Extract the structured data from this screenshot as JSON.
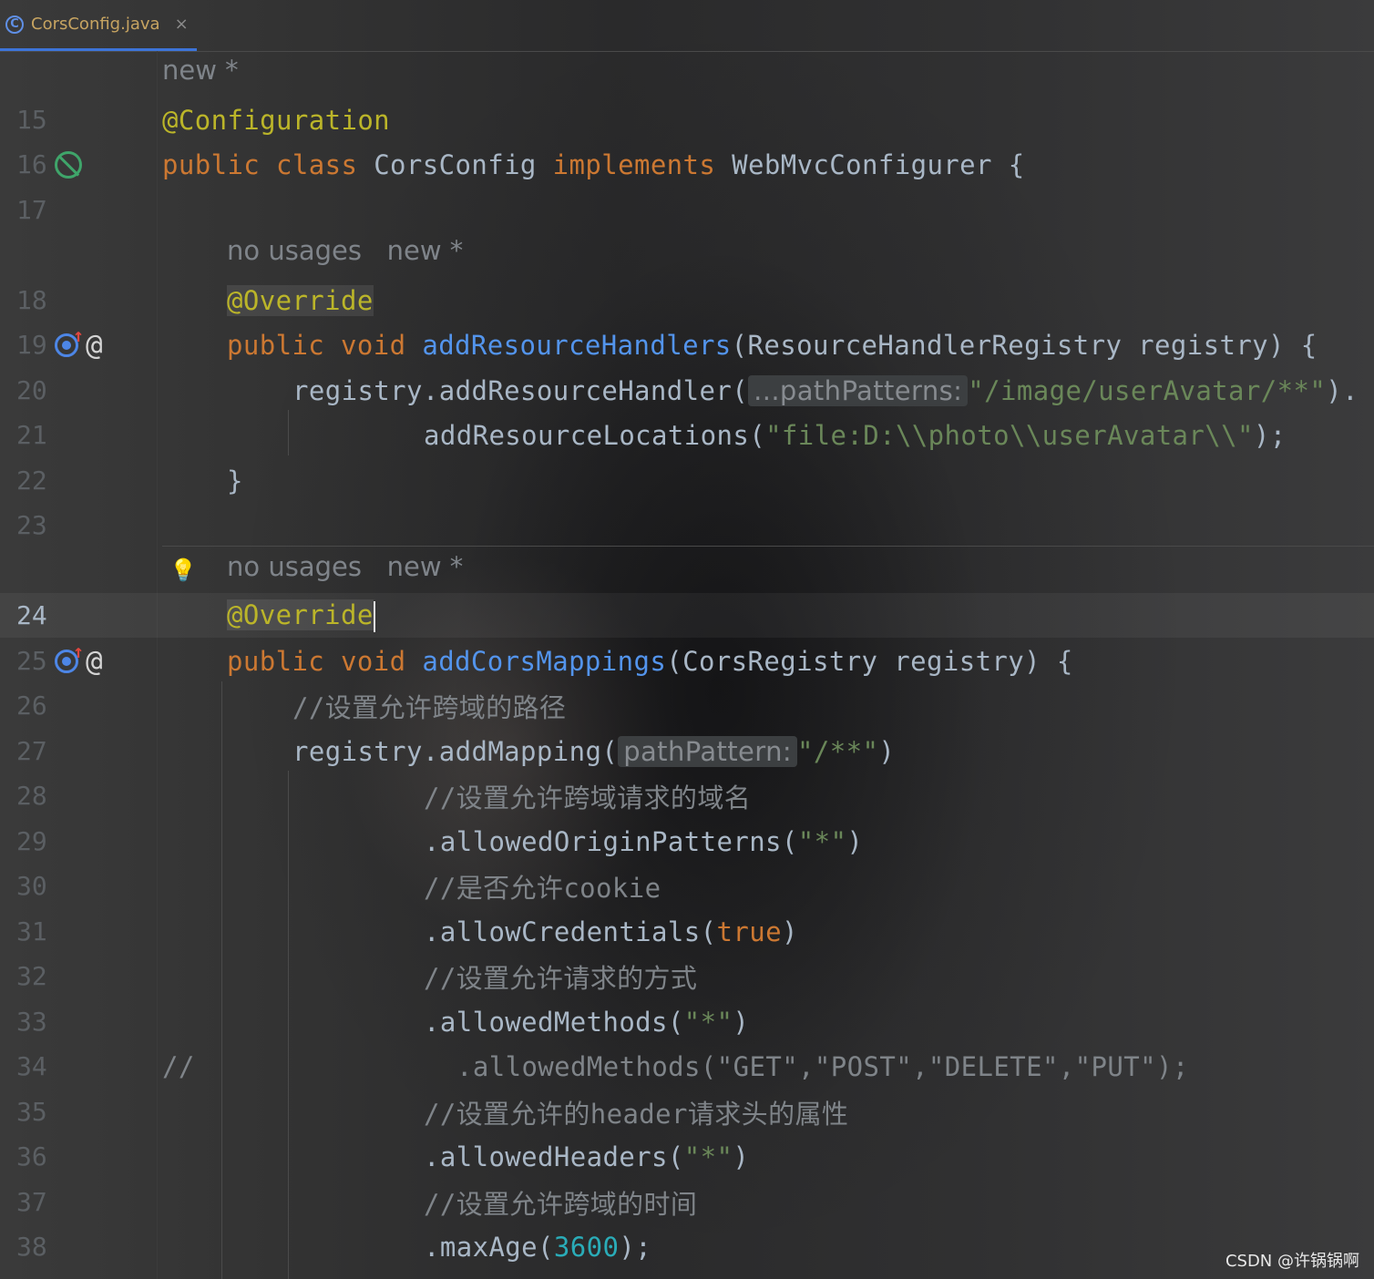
{
  "tab": {
    "icon": "class-icon",
    "icon_glyph": "C",
    "label": "CorsConfig.java",
    "close": "×"
  },
  "hints": {
    "class_author": "new *",
    "method1_usages": "no usages",
    "method1_author": "new *",
    "method2_usages": "no usages",
    "method2_author": "new *",
    "param_pathPatterns": "...pathPatterns:",
    "param_pathPattern": "pathPattern:"
  },
  "lines": {
    "n15": "15",
    "n16": "16",
    "n17": "17",
    "n18": "18",
    "n19": "19",
    "n20": "20",
    "n21": "21",
    "n22": "22",
    "n23": "23",
    "n24": "24",
    "n25": "25",
    "n26": "26",
    "n27": "27",
    "n28": "28",
    "n29": "29",
    "n30": "30",
    "n31": "31",
    "n32": "32",
    "n33": "33",
    "n34": "34",
    "n35": "35",
    "n36": "36",
    "n37": "37",
    "n38": "38"
  },
  "code": {
    "l15_ann": "@Configuration",
    "l16_kw1": "public class",
    "l16_name": " CorsConfig ",
    "l16_kw2": "implements",
    "l16_rest": " WebMvcConfigurer {",
    "l18_ann": "@Override",
    "l19_kw": "public void ",
    "l19_fn": "addResourceHandlers",
    "l19_rest": "(ResourceHandlerRegistry registry) {",
    "l20_a": "registry.addResourceHandler(",
    "l20_str": "\"/image/userAvatar/**\"",
    "l20_b": ").",
    "l21_a": "addResourceLocations(",
    "l21_str": "\"file:D:\\\\photo\\\\userAvatar\\\\\"",
    "l21_b": ");",
    "l22": "}",
    "l24_ann": "@Override",
    "l25_kw": "public void ",
    "l25_fn": "addCorsMappings",
    "l25_rest": "(CorsRegistry registry) {",
    "l26": "//设置允许跨域的路径",
    "l27_a": "registry.addMapping(",
    "l27_str": "\"/**\"",
    "l27_b": ")",
    "l28": "//设置允许跨域请求的域名",
    "l29_a": ".allowedOriginPatterns(",
    "l29_str": "\"*\"",
    "l29_b": ")",
    "l30": "//是否允许cookie",
    "l31_a": ".allowCredentials(",
    "l31_kw": "true",
    "l31_b": ")",
    "l32": "//设置允许请求的方式",
    "l33_a": ".allowedMethods(",
    "l33_str": "\"*\"",
    "l33_b": ")",
    "l34_prefix": "//",
    "l34_rest": ".allowedMethods(\"GET\",\"POST\",\"DELETE\",\"PUT\");",
    "l35": "//设置允许的header请求头的属性",
    "l36_a": ".allowedHeaders(",
    "l36_str": "\"*\"",
    "l36_b": ")",
    "l37": "//设置允许跨域的时间",
    "l38_a": ".maxAge(",
    "l38_num": "3600",
    "l38_b": ");"
  },
  "gutter_icons": {
    "l16": "no-bean-icon",
    "l19": [
      "override-icon",
      "implements-arrow-icon",
      "at-icon"
    ],
    "l24": "lightbulb-icon",
    "l25": [
      "override-icon",
      "implements-arrow-icon",
      "at-icon"
    ]
  },
  "gutter_glyphs": {
    "arrow": "↑",
    "at": "@",
    "bulb": "💡"
  },
  "watermark": "CSDN @许锅锅啊"
}
